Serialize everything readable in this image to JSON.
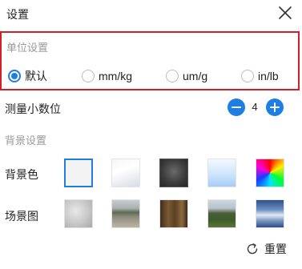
{
  "dialog": {
    "title": "设置",
    "close_icon": "close-icon"
  },
  "units": {
    "section_label": "单位设置",
    "selected": "默认",
    "options": [
      "默认",
      "mm/kg",
      "um/g",
      "in/lb"
    ]
  },
  "precision": {
    "label": "测量小数位",
    "value": "4",
    "decrement_icon": "minus-icon",
    "increment_icon": "plus-icon"
  },
  "background": {
    "section_label": "背景设置",
    "color_label": "背景色",
    "scene_label": "场景图",
    "color_swatches": [
      "blank",
      "white-gradient",
      "dark-radial",
      "sky-blue",
      "rainbow"
    ],
    "scene_swatches": [
      "gray-blur",
      "street",
      "room",
      "field",
      "sky"
    ]
  },
  "reset": {
    "label": "重置",
    "icon": "refresh-icon"
  },
  "colors": {
    "accent": "#1e7ee6",
    "highlight_border": "#d32026",
    "muted_text": "#9a9a9a"
  }
}
